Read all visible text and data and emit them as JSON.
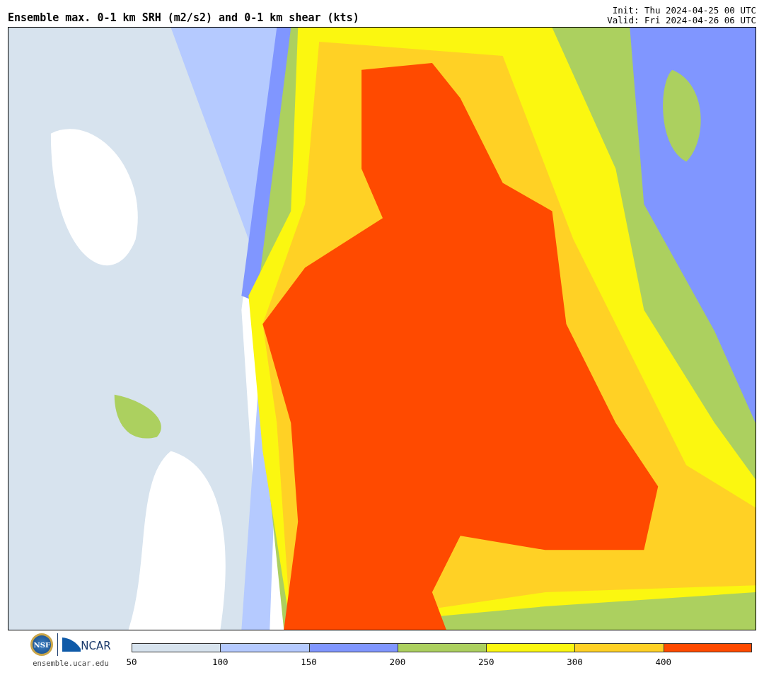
{
  "header": {
    "title": "Ensemble max. 0-1 km SRH (m2/s2) and 0-1 km shear (kts)",
    "init": "Init: Thu 2024-04-25 00 UTC",
    "valid": "Valid: Fri 2024-04-26 06 UTC"
  },
  "legend": {
    "bins": [
      {
        "color": "#d7e3ee",
        "label": "50"
      },
      {
        "color": "#b5caff",
        "label": "100"
      },
      {
        "color": "#8096ff",
        "label": "150"
      },
      {
        "color": "#acd05f",
        "label": "200"
      },
      {
        "color": "#fbf710",
        "label": "250"
      },
      {
        "color": "#ffd125",
        "label": "300"
      },
      {
        "color": "#ff4a00",
        "label": "400"
      }
    ]
  },
  "footer": {
    "seal": "NSF",
    "brand": "NCAR",
    "site": "ensemble.ucar.edu"
  }
}
